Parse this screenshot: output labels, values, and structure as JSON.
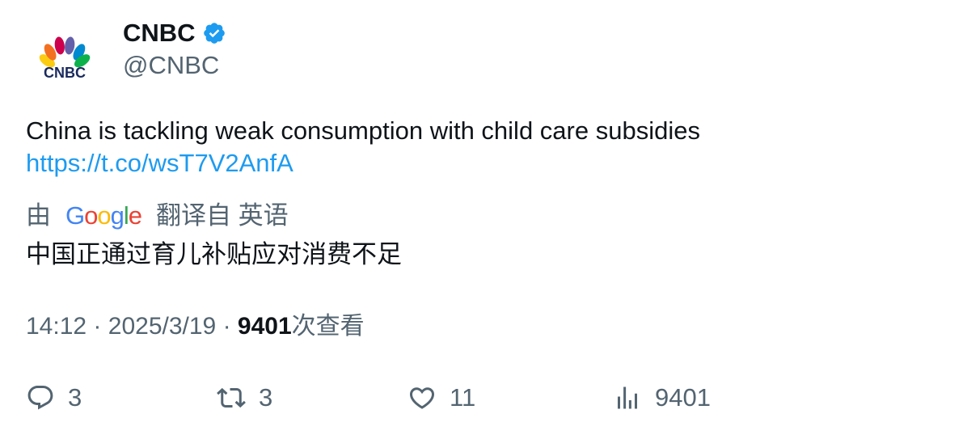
{
  "author": {
    "display_name": "CNBC",
    "handle": "@CNBC",
    "avatar_icon": "cnbc-peacock-logo",
    "avatar_text": "CNBC",
    "verified_icon": "verified-badge-icon",
    "verified_color": "#1d9bf0"
  },
  "tweet": {
    "text": "China is tackling weak consumption with child care subsidies",
    "link": "https://t.co/wsT7V2AnfA"
  },
  "translation": {
    "prefix": "由",
    "provider": "Google",
    "suffix": "翻译自 英语",
    "text": "中国正通过育儿补贴应对消费不足"
  },
  "meta": {
    "time": "14:12",
    "separator": "·",
    "date": "2025/3/19",
    "views": "9401",
    "views_label": "次查看"
  },
  "actions": {
    "reply_count": "3",
    "retweet_count": "3",
    "like_count": "11",
    "view_count": "9401"
  },
  "colors": {
    "accent": "#1d9bf0",
    "text_primary": "#0f1419",
    "text_secondary": "#536471"
  }
}
